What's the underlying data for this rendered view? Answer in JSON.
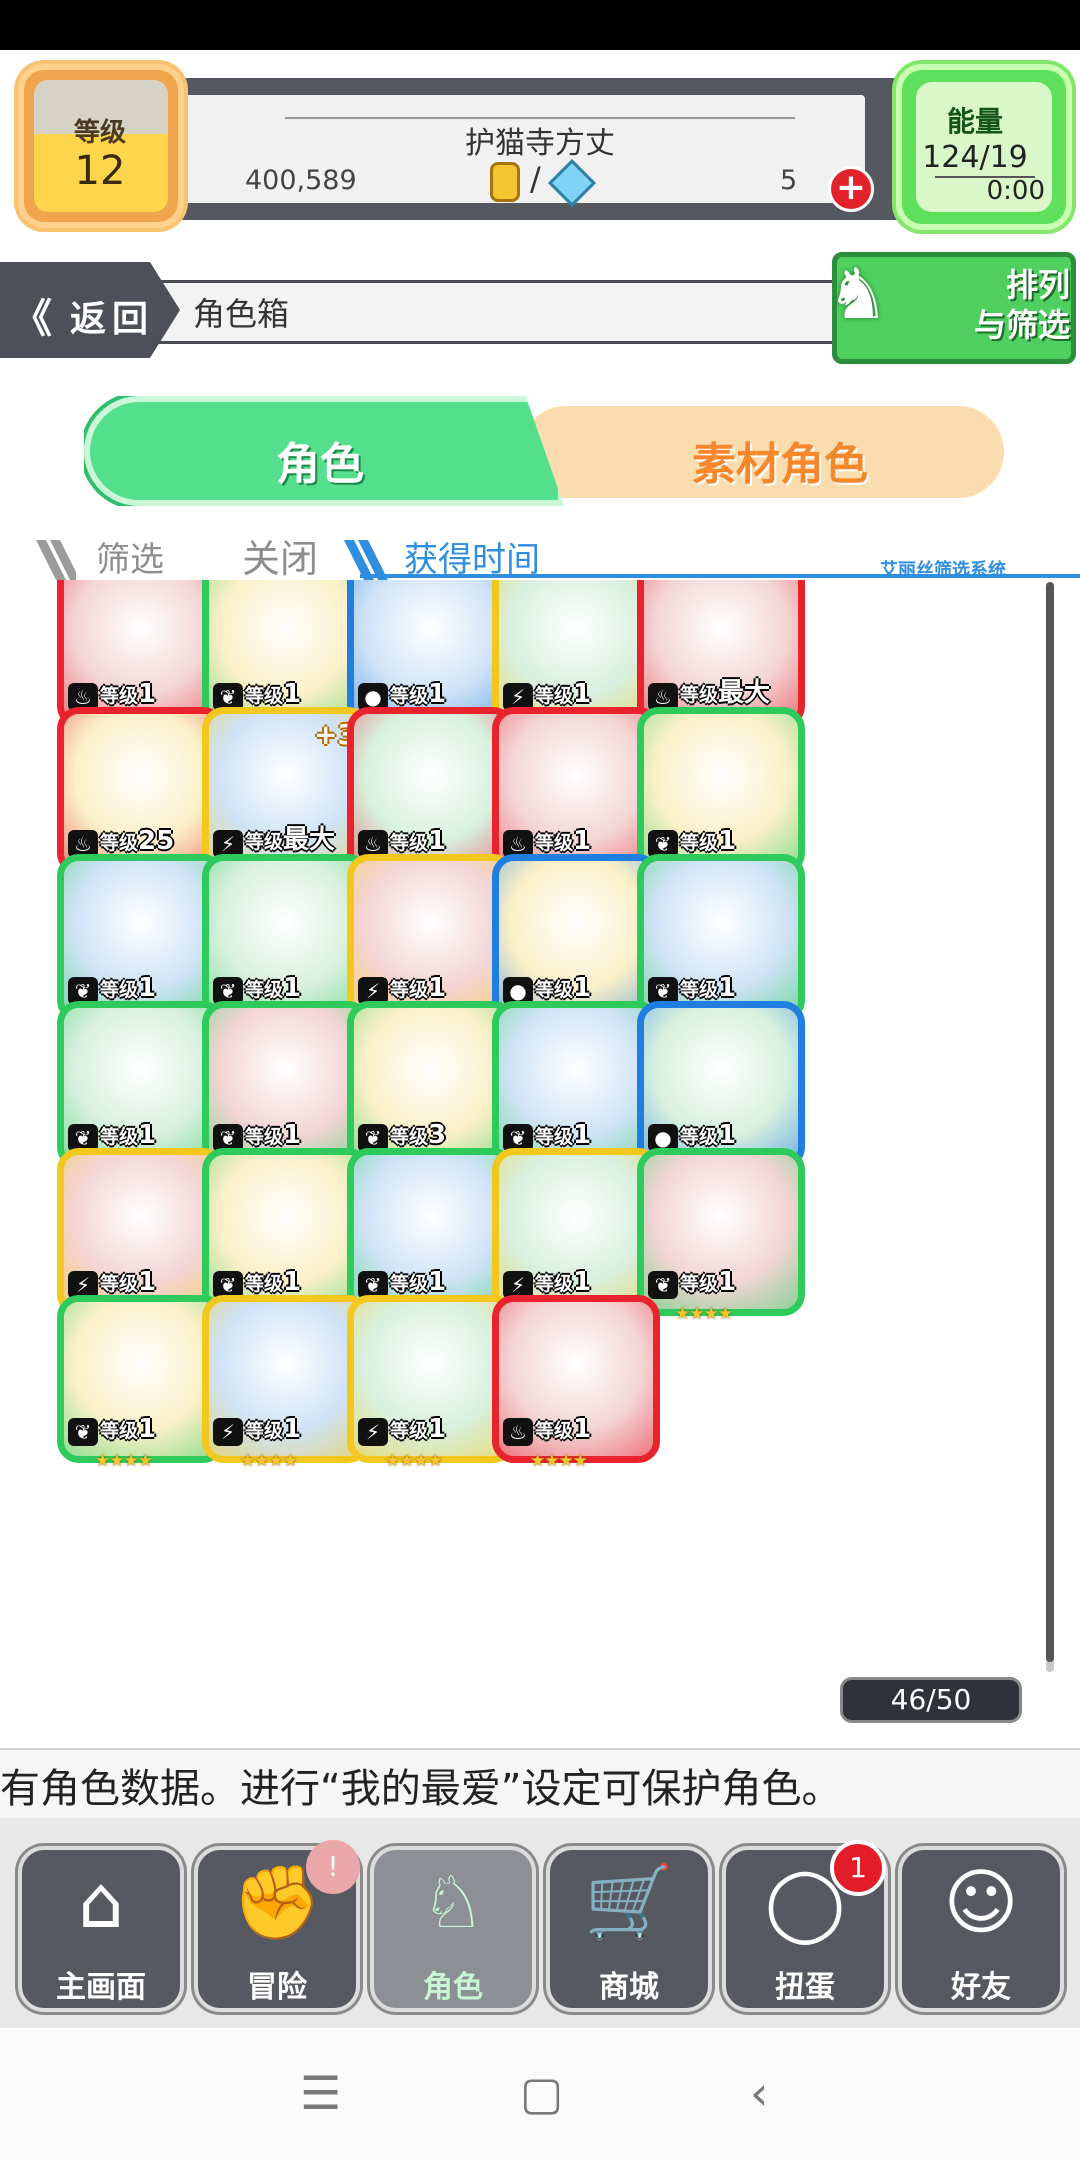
{
  "header": {
    "level_label": "等级",
    "level_value": "12",
    "player_name": "护猫寺方丈",
    "coins": "400,589",
    "separator": "/",
    "gems": "5",
    "energy_label": "能量",
    "energy_value": "124/19",
    "energy_timer": "0:00"
  },
  "titlebar": {
    "back_arrows": "《",
    "back_label": "返回",
    "title": "角色箱",
    "sort_filter_label": "排列\n与筛选"
  },
  "tabs": {
    "characters": "角色",
    "materials": "素材角色"
  },
  "filter": {
    "label": "筛选",
    "value": "关闭",
    "sort": "获得时间",
    "system": "艾丽丝筛选系统"
  },
  "cards": [
    {
      "level_prefix": "等级",
      "level": "1",
      "stars": "★★",
      "color": "#e8232e",
      "attr": "fire"
    },
    {
      "level_prefix": "等级",
      "level": "1",
      "stars": "★★★",
      "color": "#2ecb5c",
      "attr": "leaf"
    },
    {
      "level_prefix": "等级",
      "level": "1",
      "stars": "★★",
      "color": "#1e7fe0",
      "attr": "water"
    },
    {
      "level_prefix": "等级",
      "level": "1",
      "stars": "★★★",
      "color": "#f2c81e",
      "attr": "bolt"
    },
    {
      "level_prefix": "等级",
      "level": "最大",
      "stars": "★★★",
      "color": "#e8232e",
      "attr": "fire"
    },
    {
      "level_prefix": "等级",
      "level": "25",
      "stars": "★★★★",
      "color": "#e8232e",
      "attr": "fire"
    },
    {
      "level_prefix": "等级",
      "level": "最大",
      "stars": "★★★★★",
      "color": "#f2c81e",
      "attr": "bolt",
      "plus": "+3"
    },
    {
      "level_prefix": "等级",
      "level": "1",
      "stars": "★★",
      "color": "#e8232e",
      "attr": "fire"
    },
    {
      "level_prefix": "等级",
      "level": "1",
      "stars": "★★",
      "color": "#e8232e",
      "attr": "fire"
    },
    {
      "level_prefix": "等级",
      "level": "1",
      "stars": "★",
      "color": "#2ecb5c",
      "attr": "leaf"
    },
    {
      "level_prefix": "等级",
      "level": "1",
      "stars": "★",
      "color": "#2ecb5c",
      "attr": "leaf"
    },
    {
      "level_prefix": "等级",
      "level": "1",
      "stars": "★",
      "color": "#2ecb5c",
      "attr": "leaf"
    },
    {
      "level_prefix": "等级",
      "level": "1",
      "stars": "★★★★",
      "color": "#f2c81e",
      "attr": "bolt"
    },
    {
      "level_prefix": "等级",
      "level": "1",
      "stars": "★",
      "color": "#1e7fe0",
      "attr": "water"
    },
    {
      "level_prefix": "等级",
      "level": "1",
      "stars": "★",
      "color": "#2ecb5c",
      "attr": "leaf"
    },
    {
      "level_prefix": "等级",
      "level": "1",
      "stars": "★",
      "color": "#2ecb5c",
      "attr": "leaf"
    },
    {
      "level_prefix": "等级",
      "level": "1",
      "stars": "★★",
      "color": "#2ecb5c",
      "attr": "leaf"
    },
    {
      "level_prefix": "等级",
      "level": "3",
      "stars": "★",
      "color": "#2ecb5c",
      "attr": "leaf"
    },
    {
      "level_prefix": "等级",
      "level": "1",
      "stars": "★",
      "color": "#2ecb5c",
      "attr": "leaf"
    },
    {
      "level_prefix": "等级",
      "level": "1",
      "stars": "★★★★★",
      "color": "#1e7fe0",
      "attr": "water"
    },
    {
      "level_prefix": "等级",
      "level": "1",
      "stars": "★★★★",
      "color": "#f2c81e",
      "attr": "bolt"
    },
    {
      "level_prefix": "等级",
      "level": "1",
      "stars": "★★★★",
      "color": "#2ecb5c",
      "attr": "leaf"
    },
    {
      "level_prefix": "等级",
      "level": "1",
      "stars": "★★★★",
      "color": "#2ecb5c",
      "attr": "leaf"
    },
    {
      "level_prefix": "等级",
      "level": "1",
      "stars": "★★★★",
      "color": "#f2c81e",
      "attr": "bolt"
    },
    {
      "level_prefix": "等级",
      "level": "1",
      "stars": "★★★★",
      "color": "#2ecb5c",
      "attr": "leaf"
    },
    {
      "level_prefix": "等级",
      "level": "1",
      "stars": "★★★★",
      "color": "#2ecb5c",
      "attr": "leaf"
    },
    {
      "level_prefix": "等级",
      "level": "1",
      "stars": "★★★★",
      "color": "#f2c81e",
      "attr": "bolt"
    },
    {
      "level_prefix": "等级",
      "level": "1",
      "stars": "★★★★",
      "color": "#f2c81e",
      "attr": "bolt"
    },
    {
      "level_prefix": "等级",
      "level": "1",
      "stars": "★★★★",
      "color": "#e8232e",
      "attr": "fire"
    }
  ],
  "box_count": "46/50",
  "message": "有角色数据。进行“我的最爱”设定可保护角色。",
  "nav": [
    {
      "label": "主画面",
      "icon": "home-icon"
    },
    {
      "label": "冒险",
      "icon": "fist-bump-icon"
    },
    {
      "label": "角色",
      "icon": "rabbit-icon"
    },
    {
      "label": "商城",
      "icon": "cart-icon"
    },
    {
      "label": "扭蛋",
      "icon": "egg-icon"
    },
    {
      "label": "好友",
      "icon": "friends-icon"
    }
  ],
  "gacha_badge": "1",
  "adventure_badge": "!"
}
